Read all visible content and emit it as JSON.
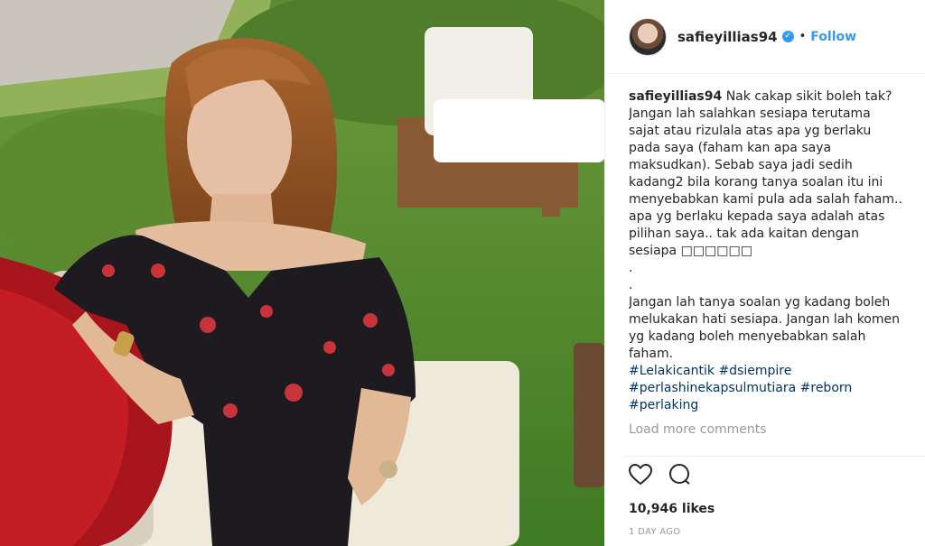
{
  "header": {
    "username": "safieyillias94",
    "verified_glyph": "✓",
    "separator": "•",
    "follow_label": "Follow"
  },
  "caption": {
    "author": "safieyillias94",
    "text": "Nak cakap sikit boleh tak? Jangan lah salahkan sesiapa terutama sajat atau rizulala atas apa yg berlaku pada saya (faham kan apa saya maksudkan). Sebab saya jadi sedih kadang2 bila korang tanya soalan itu ini menyebabkan kami pula ada salah faham.. apa yg berlaku kepada saya adalah atas pilihan saya.. tak ada kaitan dengan sesiapa □□□□□□",
    "dot1": ".",
    "dot2": ".",
    "text2": "Jangan lah tanya soalan yg kadang boleh melukakan hati sesiapa. Jangan lah komen yg kadang boleh menyebabkan salah faham.",
    "hashtags_line1": "#Lelakicantik #dsiempire",
    "hashtags_line2": "#perlashinekapsulmutiara #reborn",
    "hashtags_line3": "#perlaking"
  },
  "load_more_label": "Load more comments",
  "likes_label": "10,946 likes",
  "timestamp": "1 DAY AGO",
  "icons": [
    "heart-icon",
    "comment-icon",
    "verified-badge-icon"
  ],
  "colors": {
    "accent": "#3897f0",
    "hashtag": "#003569",
    "muted": "#999999"
  }
}
